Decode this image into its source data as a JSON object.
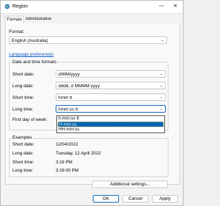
{
  "window": {
    "title": "Region"
  },
  "tabs": [
    "Formats",
    "Administrative"
  ],
  "format": {
    "label": "Format:",
    "value": "English (Australia)"
  },
  "language_link": "Language preferences",
  "date_time": {
    "title": "Date and time formats",
    "rows": [
      {
        "label": "Short date:",
        "value": "d/MM/yyyy"
      },
      {
        "label": "Long date:",
        "value": "dddd, d MMMM yyyy"
      },
      {
        "label": "Short time:",
        "value": "hmm tt"
      },
      {
        "label": "Long time:",
        "value": "hmm:ss tt"
      },
      {
        "label": "First day of week:"
      }
    ],
    "dropdown_options": [
      "h:mm:ss tt",
      "H:mm:ss",
      "HH:mm:ss"
    ],
    "selected_option": "H:mm:ss"
  },
  "examples": {
    "title": "Examples",
    "rows": [
      {
        "label": "Short date:",
        "value": "12/04/2022"
      },
      {
        "label": "Long date:",
        "value": "Tuesday, 12 April 2022"
      },
      {
        "label": "Short time:",
        "value": "3:19 PM"
      },
      {
        "label": "Long time:",
        "value": "3:19:00 PM"
      }
    ]
  },
  "buttons": {
    "additional": "Additional settings...",
    "ok": "OK",
    "cancel": "Cancel",
    "apply": "Apply"
  },
  "colors": {
    "accent": "#0063b1",
    "link": "#0a58ca"
  },
  "icons": {
    "app": "region-icon",
    "minimize": "minimize-icon",
    "close": "close-icon",
    "chevron": "chevron-down-icon"
  }
}
